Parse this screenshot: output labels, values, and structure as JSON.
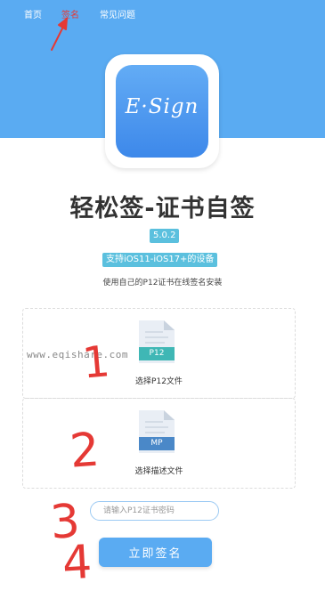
{
  "nav": [
    {
      "label": "首页"
    },
    {
      "label": "签名",
      "active": true,
      "color": "#e53935"
    },
    {
      "label": "常见问题"
    }
  ],
  "colors": {
    "hero": "#5aabf2",
    "badge": "#5bc0de",
    "button": "#5aabf2",
    "annotation": "#e53935"
  },
  "app": {
    "logo_text": "E·Sign",
    "title": "轻松签-证书自签",
    "version": "5.0.2",
    "compat": "支持iOS11-iOS17+的设备",
    "subtitle": "使用自己的P12证书在线签名安装"
  },
  "uploads": [
    {
      "label": "选择P12文件",
      "badge": "P12",
      "icon": "file-p12-icon"
    },
    {
      "label": "选择描述文件",
      "badge": "MP",
      "icon": "file-mobileprovision-icon"
    }
  ],
  "watermark": "www.eqishare.com",
  "password": {
    "placeholder": "请输入P12证书密码",
    "value": ""
  },
  "sign_button": {
    "label": "立即签名"
  },
  "annotations": [
    "1",
    "2",
    "3",
    "4"
  ]
}
